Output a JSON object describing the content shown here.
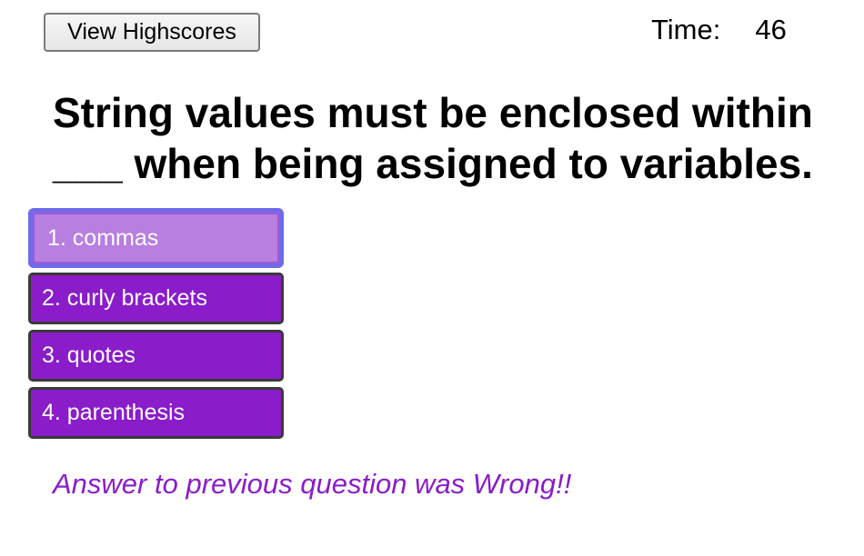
{
  "header": {
    "highscores_label": "View Highscores",
    "timer_label": "Time:",
    "timer_value": "46"
  },
  "quiz": {
    "question": "String values must be enclosed within\n___ when being assigned to variables.",
    "choices": [
      {
        "label": "1. commas",
        "state": "focused"
      },
      {
        "label": "2. curly brackets",
        "state": "normal"
      },
      {
        "label": "3. quotes",
        "state": "normal"
      },
      {
        "label": "4. parenthesis",
        "state": "normal"
      }
    ],
    "result_message": "Answer to previous question was Wrong!!"
  },
  "colors": {
    "choice_background": "#8a1cc9",
    "choice_focused_background": "#b87ee0",
    "focus_ring": "#6f6bea",
    "result_text": "#8a1cc9"
  }
}
